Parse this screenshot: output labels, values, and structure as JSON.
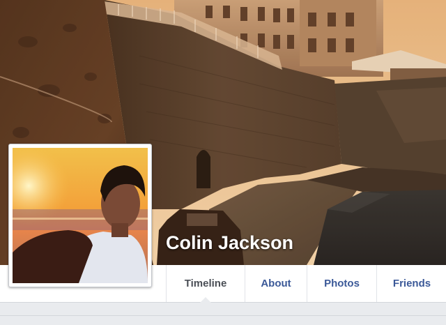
{
  "profile": {
    "name": "Colin Jackson"
  },
  "nav": {
    "tabs": [
      {
        "label": "Timeline",
        "active": true
      },
      {
        "label": "About",
        "active": false
      },
      {
        "label": "Photos",
        "active": false
      },
      {
        "label": "Friends",
        "active": false
      }
    ]
  },
  "colors": {
    "link": "#3b5998",
    "active_tab": "#4b4f56",
    "page_background": "#e9ebee"
  }
}
